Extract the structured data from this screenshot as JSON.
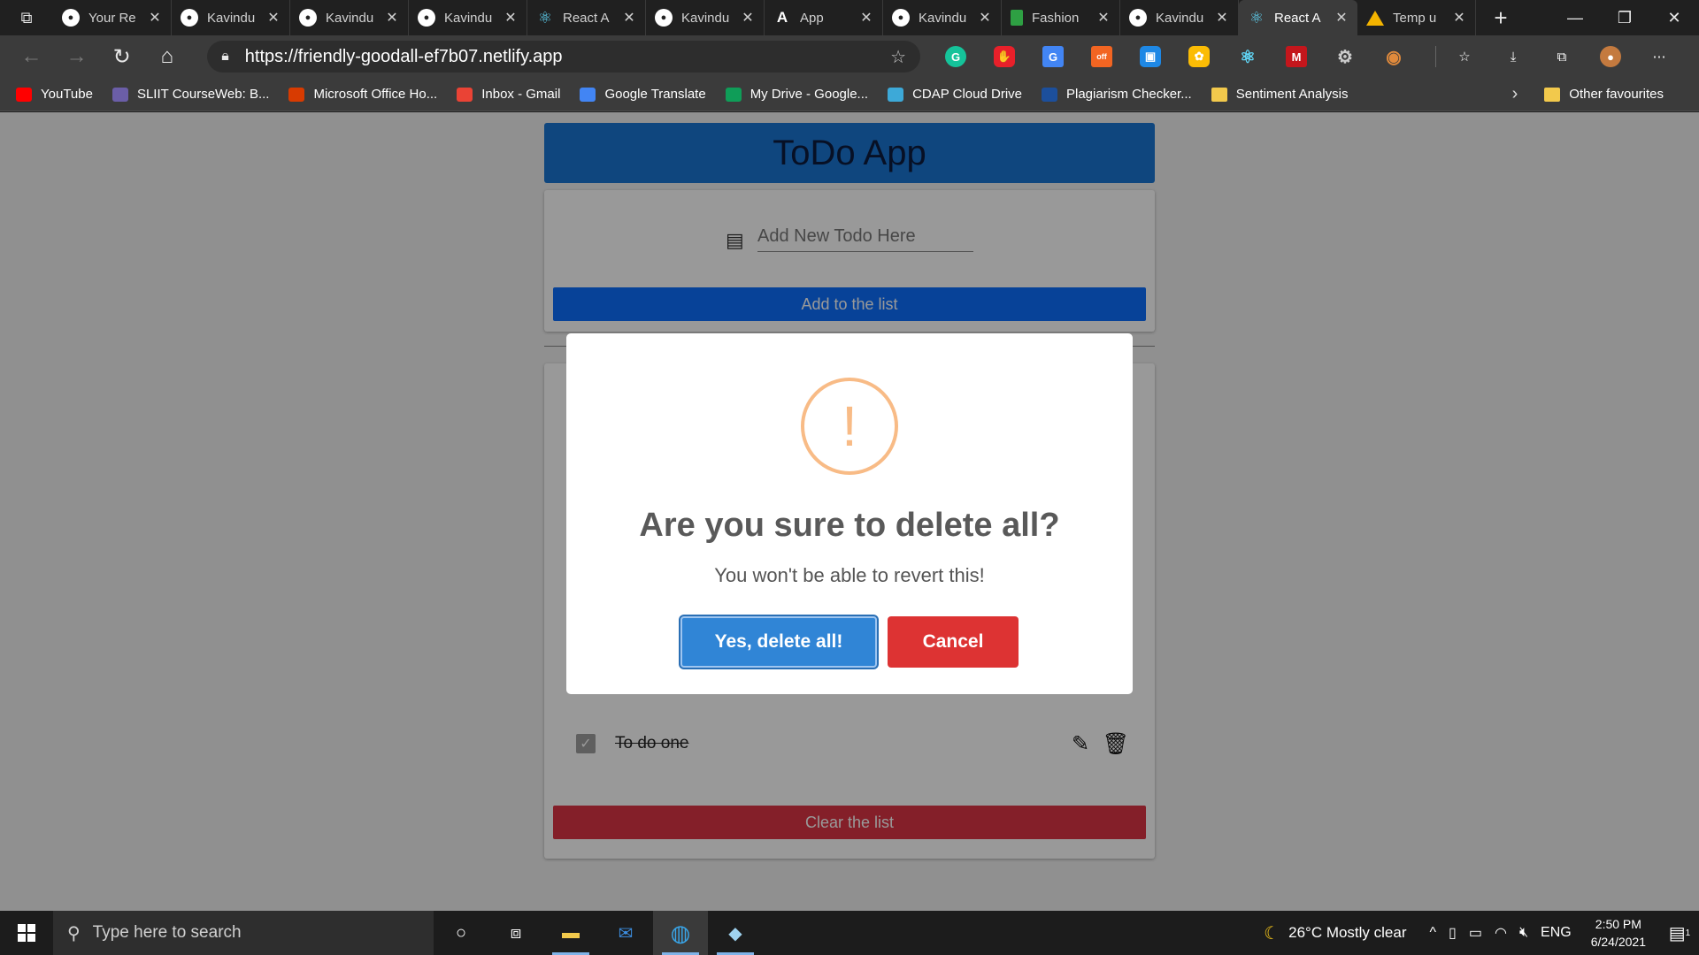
{
  "browser": {
    "tabs": [
      {
        "title": "Your Re",
        "favicon": "github-icon"
      },
      {
        "title": "Kavindu",
        "favicon": "github-icon"
      },
      {
        "title": "Kavindu",
        "favicon": "github-icon"
      },
      {
        "title": "Kavindu",
        "favicon": "github-icon"
      },
      {
        "title": "React A",
        "favicon": "react-icon"
      },
      {
        "title": "Kavindu",
        "favicon": "github-icon"
      },
      {
        "title": "App",
        "favicon": "app-icon"
      },
      {
        "title": "Kavindu",
        "favicon": "github-icon"
      },
      {
        "title": "Fashion",
        "favicon": "sheet-icon"
      },
      {
        "title": "Kavindu",
        "favicon": "github-icon"
      },
      {
        "title": "React A",
        "favicon": "react-icon",
        "active": true
      },
      {
        "title": "Temp u",
        "favicon": "drive-icon"
      }
    ],
    "url": "https://friendly-goodall-ef7b07.netlify.app",
    "favorites": [
      {
        "label": "YouTube",
        "color": "#ff0000"
      },
      {
        "label": "SLIIT CourseWeb: B...",
        "color": "#6b5ea8"
      },
      {
        "label": "Microsoft Office Ho...",
        "color": "#d83b01"
      },
      {
        "label": "Inbox - Gmail",
        "color": "#ea4335"
      },
      {
        "label": "Google Translate",
        "color": "#4285f4"
      },
      {
        "label": "My Drive - Google...",
        "color": "#0f9d58"
      },
      {
        "label": "CDAP Cloud Drive",
        "color": "#3da9d8"
      },
      {
        "label": "Plagiarism Checker...",
        "color": "#1c4f9c"
      },
      {
        "label": "Sentiment Analysis",
        "color": "folder"
      }
    ],
    "other_favourites": "Other favourites"
  },
  "app": {
    "title": "ToDo App",
    "input_placeholder": "Add New Todo Here",
    "add_button": "Add to the list",
    "todo_items": [
      {
        "text": "To do one",
        "completed": true
      }
    ],
    "clear_button": "Clear the list"
  },
  "dialog": {
    "icon": "!",
    "title": "Are you sure to delete all?",
    "text": "You won't be able to revert this!",
    "confirm_label": "Yes, delete all!",
    "cancel_label": "Cancel",
    "colors": {
      "confirm": "#3085d6",
      "cancel": "#dd3333",
      "warning": "#f8bb86"
    }
  },
  "taskbar": {
    "search_placeholder": "Type here to search",
    "weather": "26°C  Mostly clear",
    "language": "ENG",
    "time": "2:50 PM",
    "date": "6/24/2021",
    "notification_count": "1"
  }
}
